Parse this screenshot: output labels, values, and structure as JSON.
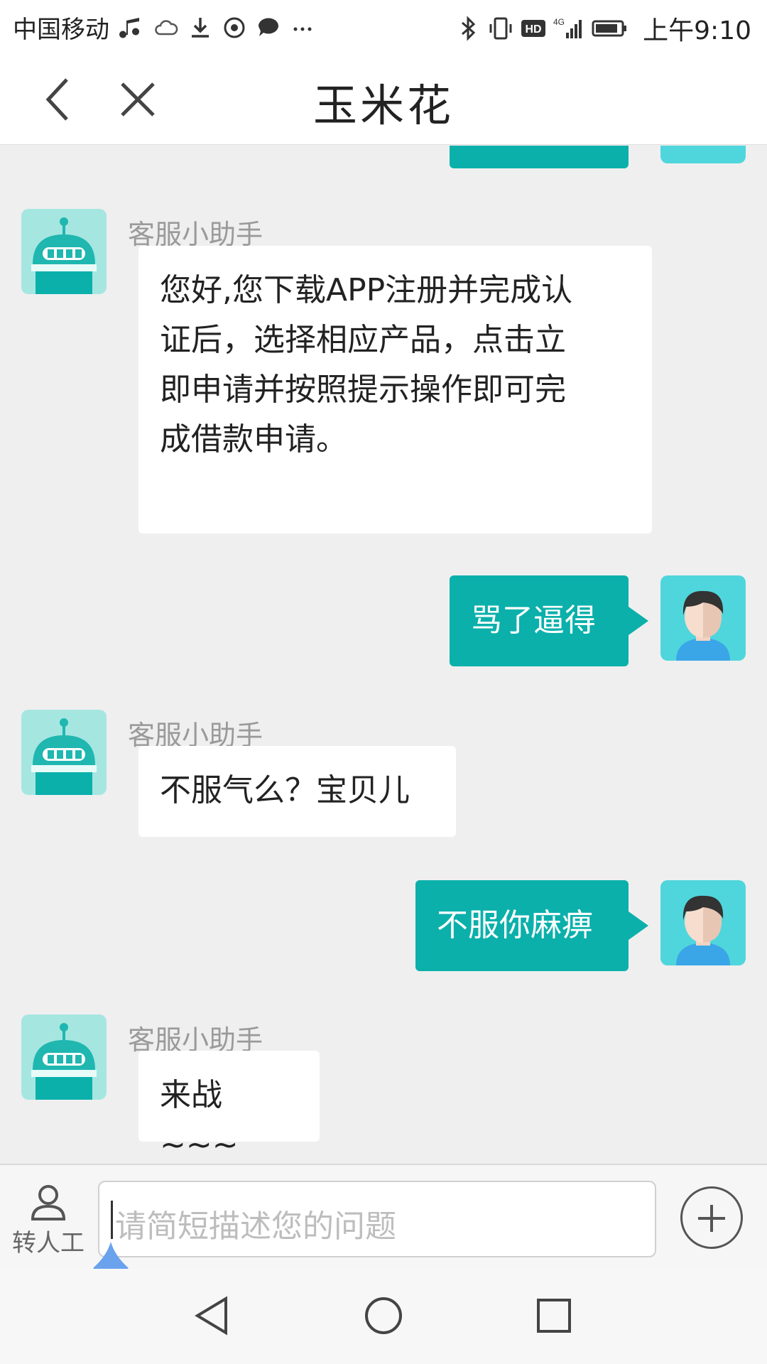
{
  "status_bar": {
    "carrier": "中国移动",
    "time": "上午9:10",
    "icons_left": [
      "music-icon",
      "cloud-icon",
      "download-icon",
      "app-icon",
      "message-icon",
      "more-dots-icon"
    ],
    "icons_right": [
      "bluetooth-icon",
      "vibrate-icon",
      "hd-icon",
      "signal-4g-icon",
      "battery-icon"
    ],
    "network": "4G",
    "hd": "HD"
  },
  "header": {
    "title": "玉米花",
    "back_icon": "chevron-left-icon",
    "close_icon": "close-icon"
  },
  "messages": [
    {
      "from": "bot",
      "sender": "客服小助手",
      "lines": [
        "您好,您下载APP注册并完成认",
        "证后，选择相应产品，点击立",
        "即申请并按照提示操作即可完",
        "成借款申请。"
      ]
    },
    {
      "from": "user",
      "text": "骂了逼得"
    },
    {
      "from": "bot",
      "sender": "客服小助手",
      "text": "不服气么？宝贝儿"
    },
    {
      "from": "user",
      "text": "不服你麻痹"
    },
    {
      "from": "bot",
      "sender": "客服小助手",
      "text": "来战~~~"
    }
  ],
  "input_bar": {
    "agent_label": "转人工",
    "placeholder": "请简短描述您的问题"
  },
  "colors": {
    "accent": "#0bb0ab",
    "bot_avatar_bg": "#a6e6e1",
    "user_avatar_bg": "#4fd6dc",
    "chat_bg": "#efefef",
    "drop_handle": "#6aa2ee"
  },
  "nav_bar": {
    "icons": [
      "nav-back-icon",
      "nav-home-icon",
      "nav-recents-icon"
    ]
  }
}
